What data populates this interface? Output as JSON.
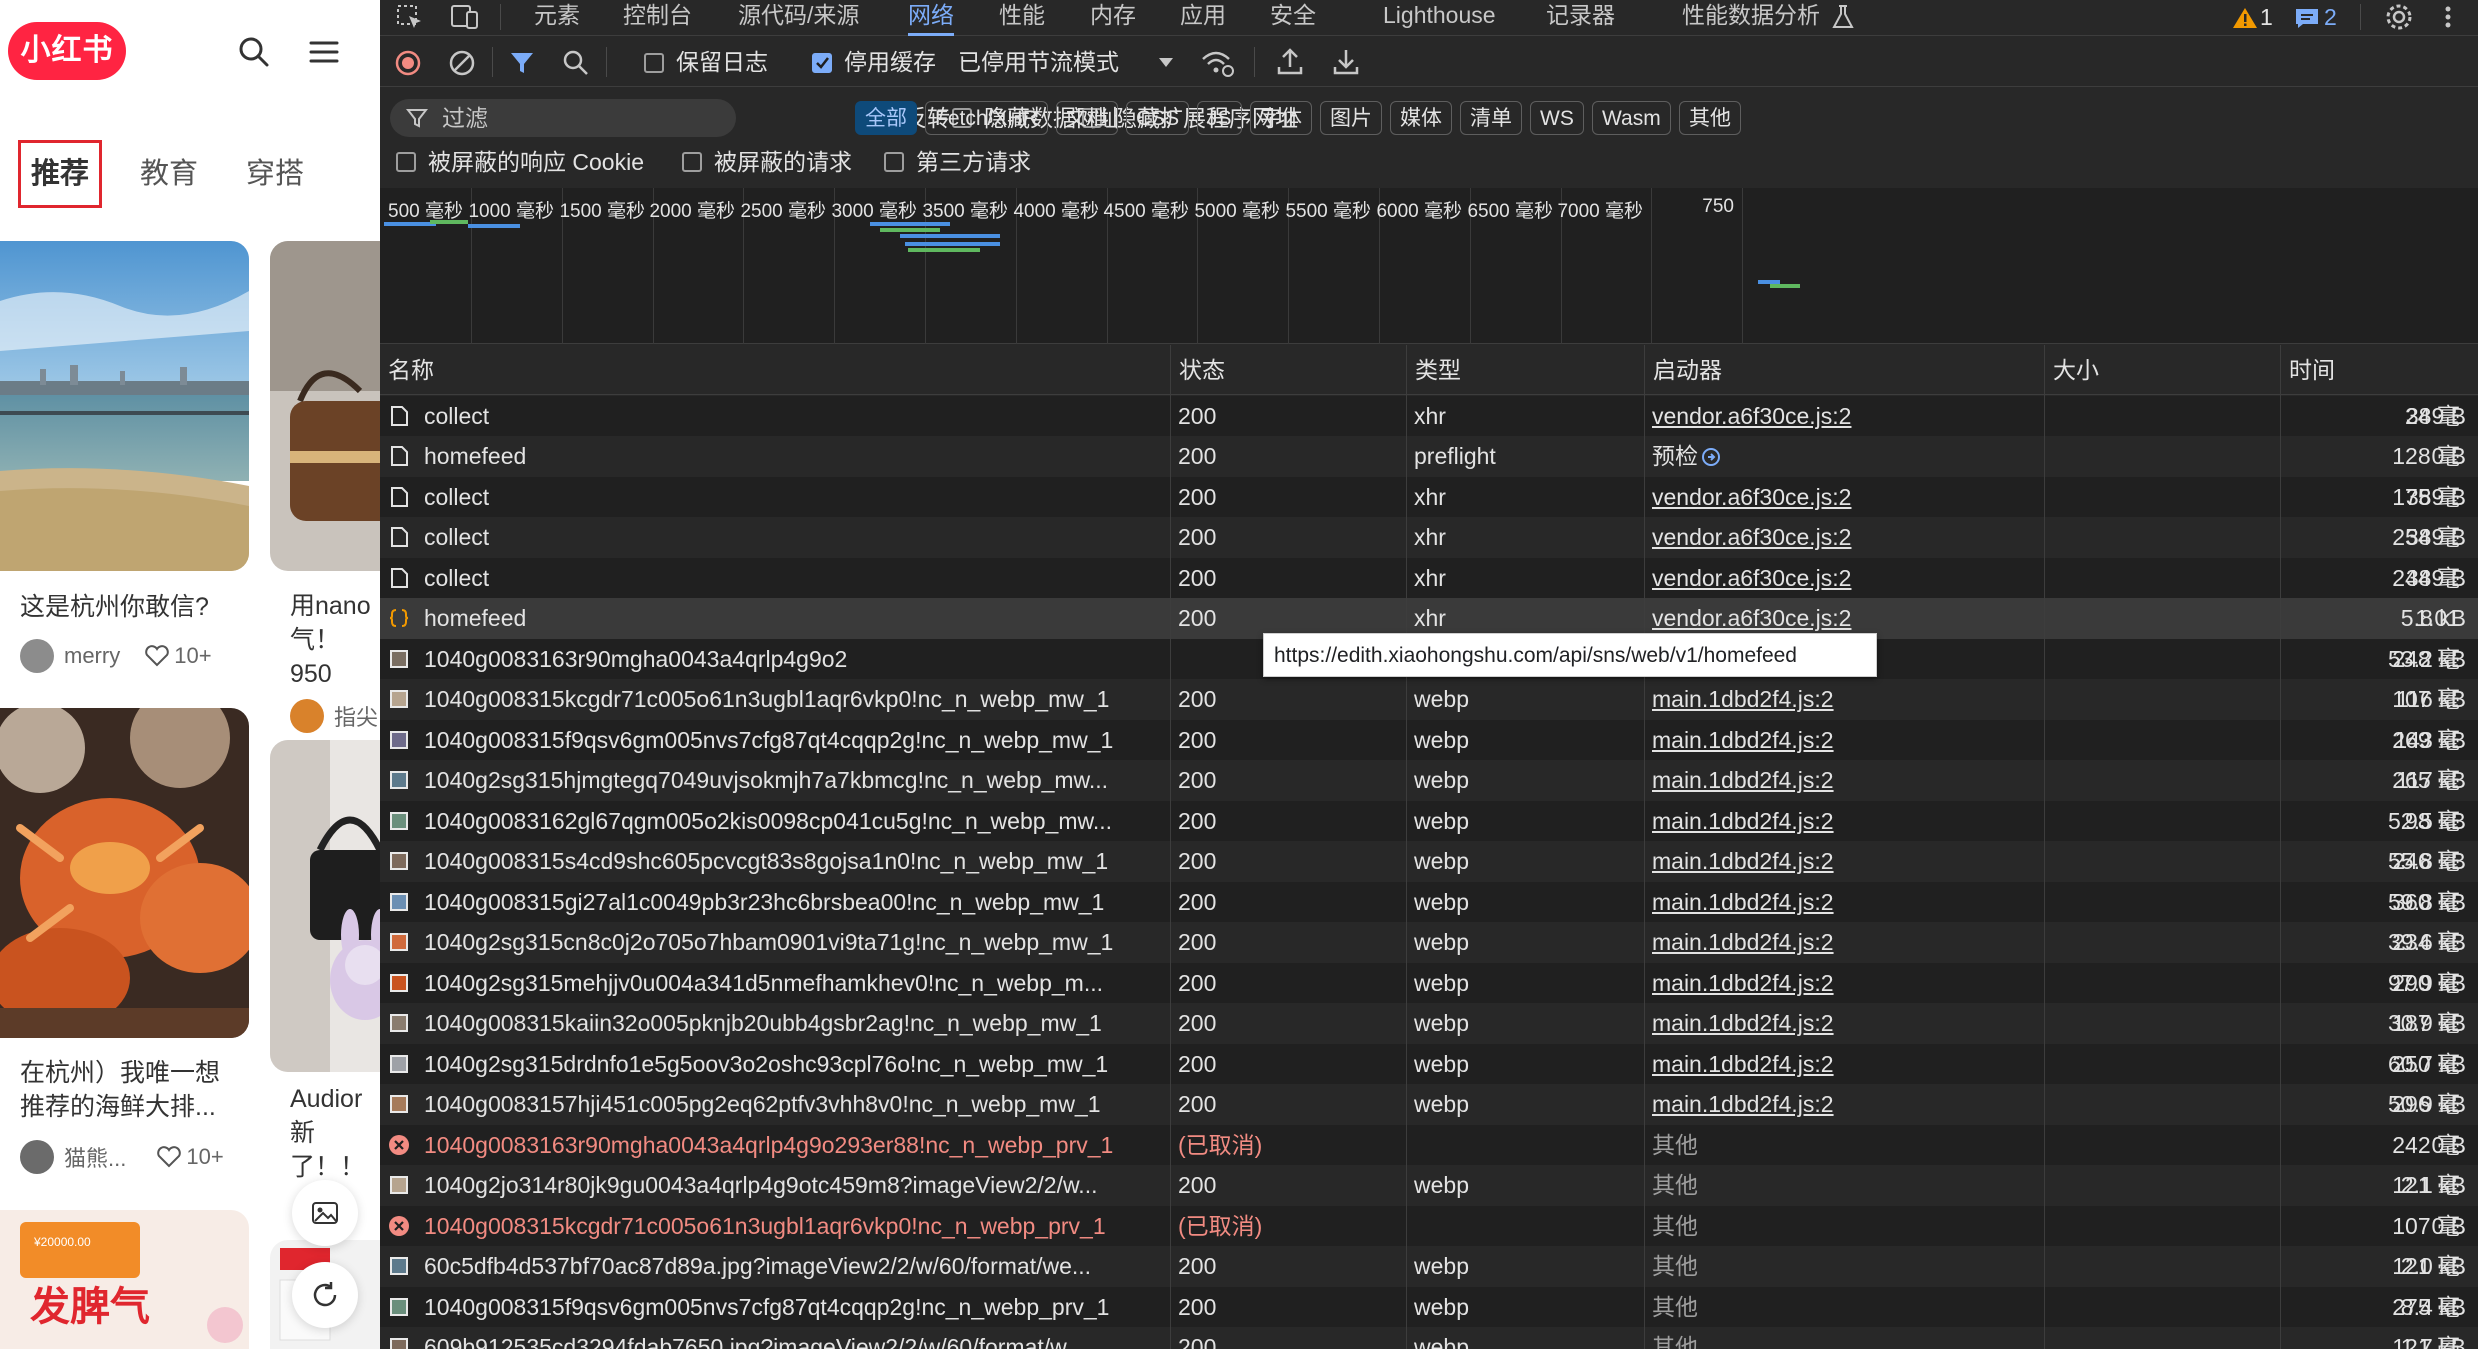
{
  "xhs": {
    "logo": "小红书",
    "tabs": [
      "推荐",
      "教育",
      "穿搭"
    ],
    "cards": [
      {
        "title": "这是杭州你敢信?",
        "author": "merry",
        "likes": "10+"
      },
      {
        "title": "用nano",
        "title2": "气！950",
        "author": "指尖"
      },
      {
        "title": "在杭州）我唯一想",
        "title2": "推荐的海鲜大排...",
        "author": "猫熊...",
        "likes": "10+"
      },
      {
        "title": "Audior新",
        "title2": "了！！"
      }
    ],
    "promo_price": "¥20000.00"
  },
  "devtools": {
    "tabs": [
      "元素",
      "控制台",
      "源代码/来源",
      "网络",
      "性能",
      "内存",
      "应用",
      "安全",
      "Lighthouse",
      "记录器",
      "性能数据分析"
    ],
    "active_tab": "网络",
    "warning_count": "1",
    "message_count": "2",
    "toolbar": {
      "preserve_log": "保留日志",
      "disable_cache": "停用缓存",
      "throttling": "已停用节流模式"
    },
    "filter": {
      "placeholder": "过滤",
      "invert": "反转",
      "hide_data_urls": "隐藏数据网址",
      "hide_ext_urls": "隐藏扩展程序网址",
      "types": [
        "全部",
        "Fetch/XHR",
        "文档",
        "CSS",
        "JS",
        "字体",
        "图片",
        "媒体",
        "清单",
        "WS",
        "Wasm",
        "其他"
      ],
      "blocked_cookies": "被屏蔽的响应 Cookie",
      "blocked_requests": "被屏蔽的请求",
      "third_party": "第三方请求"
    },
    "timeline_labels": [
      "500 毫秒",
      "1000 毫秒",
      "1500 毫秒",
      "2000 毫秒",
      "2500 毫秒",
      "3000 毫秒",
      "3500 毫秒",
      "4000 毫秒",
      "4500 毫秒",
      "5000 毫秒",
      "5500 毫秒",
      "6000 毫秒",
      "6500 毫秒",
      "7000 毫秒",
      "750"
    ],
    "columns": {
      "name": "名称",
      "status": "状态",
      "type": "类型",
      "initiator": "启动器",
      "size": "大小",
      "time": "时间"
    },
    "tooltip": "https://edith.xiaohongshu.com/api/sns/web/v1/homefeed",
    "rows": [
      {
        "icon": "doc",
        "name": "collect",
        "status": "200",
        "type": "xhr",
        "initiator": "vendor.a6f30ce.js:2",
        "size": "389 B",
        "time": "24 毫"
      },
      {
        "icon": "doc",
        "name": "homefeed",
        "status": "200",
        "type": "preflight",
        "initiator": "预检",
        "size": "0 B",
        "time": "128 毫"
      },
      {
        "icon": "doc",
        "name": "collect",
        "status": "200",
        "type": "xhr",
        "initiator": "vendor.a6f30ce.js:2",
        "size": "389 B",
        "time": "175 毫"
      },
      {
        "icon": "doc",
        "name": "collect",
        "status": "200",
        "type": "xhr",
        "initiator": "vendor.a6f30ce.js:2",
        "size": "389 B",
        "time": "254 毫"
      },
      {
        "icon": "doc",
        "name": "collect",
        "status": "200",
        "type": "xhr",
        "initiator": "vendor.a6f30ce.js:2",
        "size": "389 B",
        "time": "244 毫"
      },
      {
        "icon": "fetch",
        "name": "homefeed",
        "status": "200",
        "type": "xhr",
        "initiator": "vendor.a6f30ce.js:2",
        "size": "5.8 kB",
        "time": "1.01"
      },
      {
        "icon": "img",
        "name": "1040g0083163r90mgha0043a4qrlp4g9o2",
        "status": "",
        "type": "",
        "initiator": "main.1dbd2f4.js:2",
        "size": "53.2 kB",
        "time": "248 毫"
      },
      {
        "icon": "img",
        "name": "1040g008315kcgdr71c005o61n3ugbl1aqr6vkp0!nc_n_webp_mw_1",
        "status": "200",
        "type": "webp",
        "initiator": "main.1dbd2f4.js:2",
        "size": "116 kB",
        "time": "107 毫"
      },
      {
        "icon": "img",
        "name": "1040g008315f9qsv6gm005nvs7cfg87qt4cqqp2g!nc_n_webp_mw_1",
        "status": "200",
        "type": "webp",
        "initiator": "main.1dbd2f4.js:2",
        "size": "143 kB",
        "time": "269 毫"
      },
      {
        "icon": "img",
        "name": "1040g2sg315hjmgtegq7049uvjsokmjh7a7kbmcg!nc_n_webp_mw...",
        "status": "200",
        "type": "webp",
        "initiator": "main.1dbd2f4.js:2",
        "size": "117 kB",
        "time": "265 毫"
      },
      {
        "icon": "img",
        "name": "1040g0083162gl67qgm005o2kis0098cp041cu5g!nc_n_webp_mw...",
        "status": "200",
        "type": "webp",
        "initiator": "main.1dbd2f4.js:2",
        "size": "52.5 kB",
        "time": "98 毫"
      },
      {
        "icon": "img",
        "name": "1040g008315s4cd9shc605pcvcgt83s8gojsa1n0!nc_n_webp_mw_1",
        "status": "200",
        "type": "webp",
        "initiator": "main.1dbd2f4.js:2",
        "size": "55.8 kB",
        "time": "246 毫"
      },
      {
        "icon": "img",
        "name": "1040g008315gi27al1c0049pb3r23hc6brsbea00!nc_n_webp_mw_1",
        "status": "200",
        "type": "webp",
        "initiator": "main.1dbd2f4.js:2",
        "size": "59.8 kB",
        "time": "360 毫"
      },
      {
        "icon": "img",
        "name": "1040g2sg315cn8c0j2o705o7hbam0901vi9ta71g!nc_n_webp_mw_1",
        "status": "200",
        "type": "webp",
        "initiator": "main.1dbd2f4.js:2",
        "size": "39.6 kB",
        "time": "234 毫"
      },
      {
        "icon": "img",
        "name": "1040g2sg315mehjjv0u004a341d5nmefhamkhev0!nc_n_webp_m...",
        "status": "200",
        "type": "webp",
        "initiator": "main.1dbd2f4.js:2",
        "size": "97.9 kB",
        "time": "290 毫"
      },
      {
        "icon": "img",
        "name": "1040g008315kaiin32o005pknjb20ubb4gsbr2ag!nc_n_webp_mw_1",
        "status": "200",
        "type": "webp",
        "initiator": "main.1dbd2f4.js:2",
        "size": "30.9 kB",
        "time": "187 毫"
      },
      {
        "icon": "img",
        "name": "1040g2sg315drdnfo1e5g5oov3o2oshc93cpl76o!nc_n_webp_mw_1",
        "status": "200",
        "type": "webp",
        "initiator": "main.1dbd2f4.js:2",
        "size": "60.7 kB",
        "time": "250 毫"
      },
      {
        "icon": "img",
        "name": "1040g0083157hji451c005pg2eq62ptfv3vhh8v0!nc_n_webp_mw_1",
        "status": "200",
        "type": "webp",
        "initiator": "main.1dbd2f4.js:2",
        "size": "50.9 kB",
        "time": "296 毫"
      },
      {
        "icon": "err",
        "name": "1040g0083163r90mgha0043a4qrlp4g9o293er88!nc_n_webp_prv_1",
        "status": "(已取消)",
        "type": "",
        "initiator": "其他",
        "size": "0 B",
        "time": "242 毫"
      },
      {
        "icon": "img",
        "name": "1040g2jo314r80jk9gu0043a4qrlp4g9otc459m8?imageView2/2/w...",
        "status": "200",
        "type": "webp",
        "initiator": "其他",
        "size": "2.1 kB",
        "time": "121 毫"
      },
      {
        "icon": "err",
        "name": "1040g008315kcgdr71c005o61n3ugbl1aqr6vkp0!nc_n_webp_prv_1",
        "status": "(已取消)",
        "type": "",
        "initiator": "其他",
        "size": "0 B",
        "time": "107 毫"
      },
      {
        "icon": "img",
        "name": "60c5dfb4d537bf70ac87d89a.jpg?imageView2/2/w/60/format/we...",
        "status": "200",
        "type": "webp",
        "initiator": "其他",
        "size": "2.0 kB",
        "time": "121 毫"
      },
      {
        "icon": "img",
        "name": "1040g008315f9qsv6gm005nvs7cfg87qt4cqqp2g!nc_n_webp_prv_1",
        "status": "200",
        "type": "webp",
        "initiator": "其他",
        "size": "8.4 kB",
        "time": "275 毫"
      },
      {
        "icon": "img",
        "name": "609b912535cd3294fdab7650.jpg?imageView2/2/w/60/format/w...",
        "status": "200",
        "type": "webp",
        "initiator": "其他",
        "size": "1.7 kB",
        "time": "121 毫"
      }
    ]
  }
}
